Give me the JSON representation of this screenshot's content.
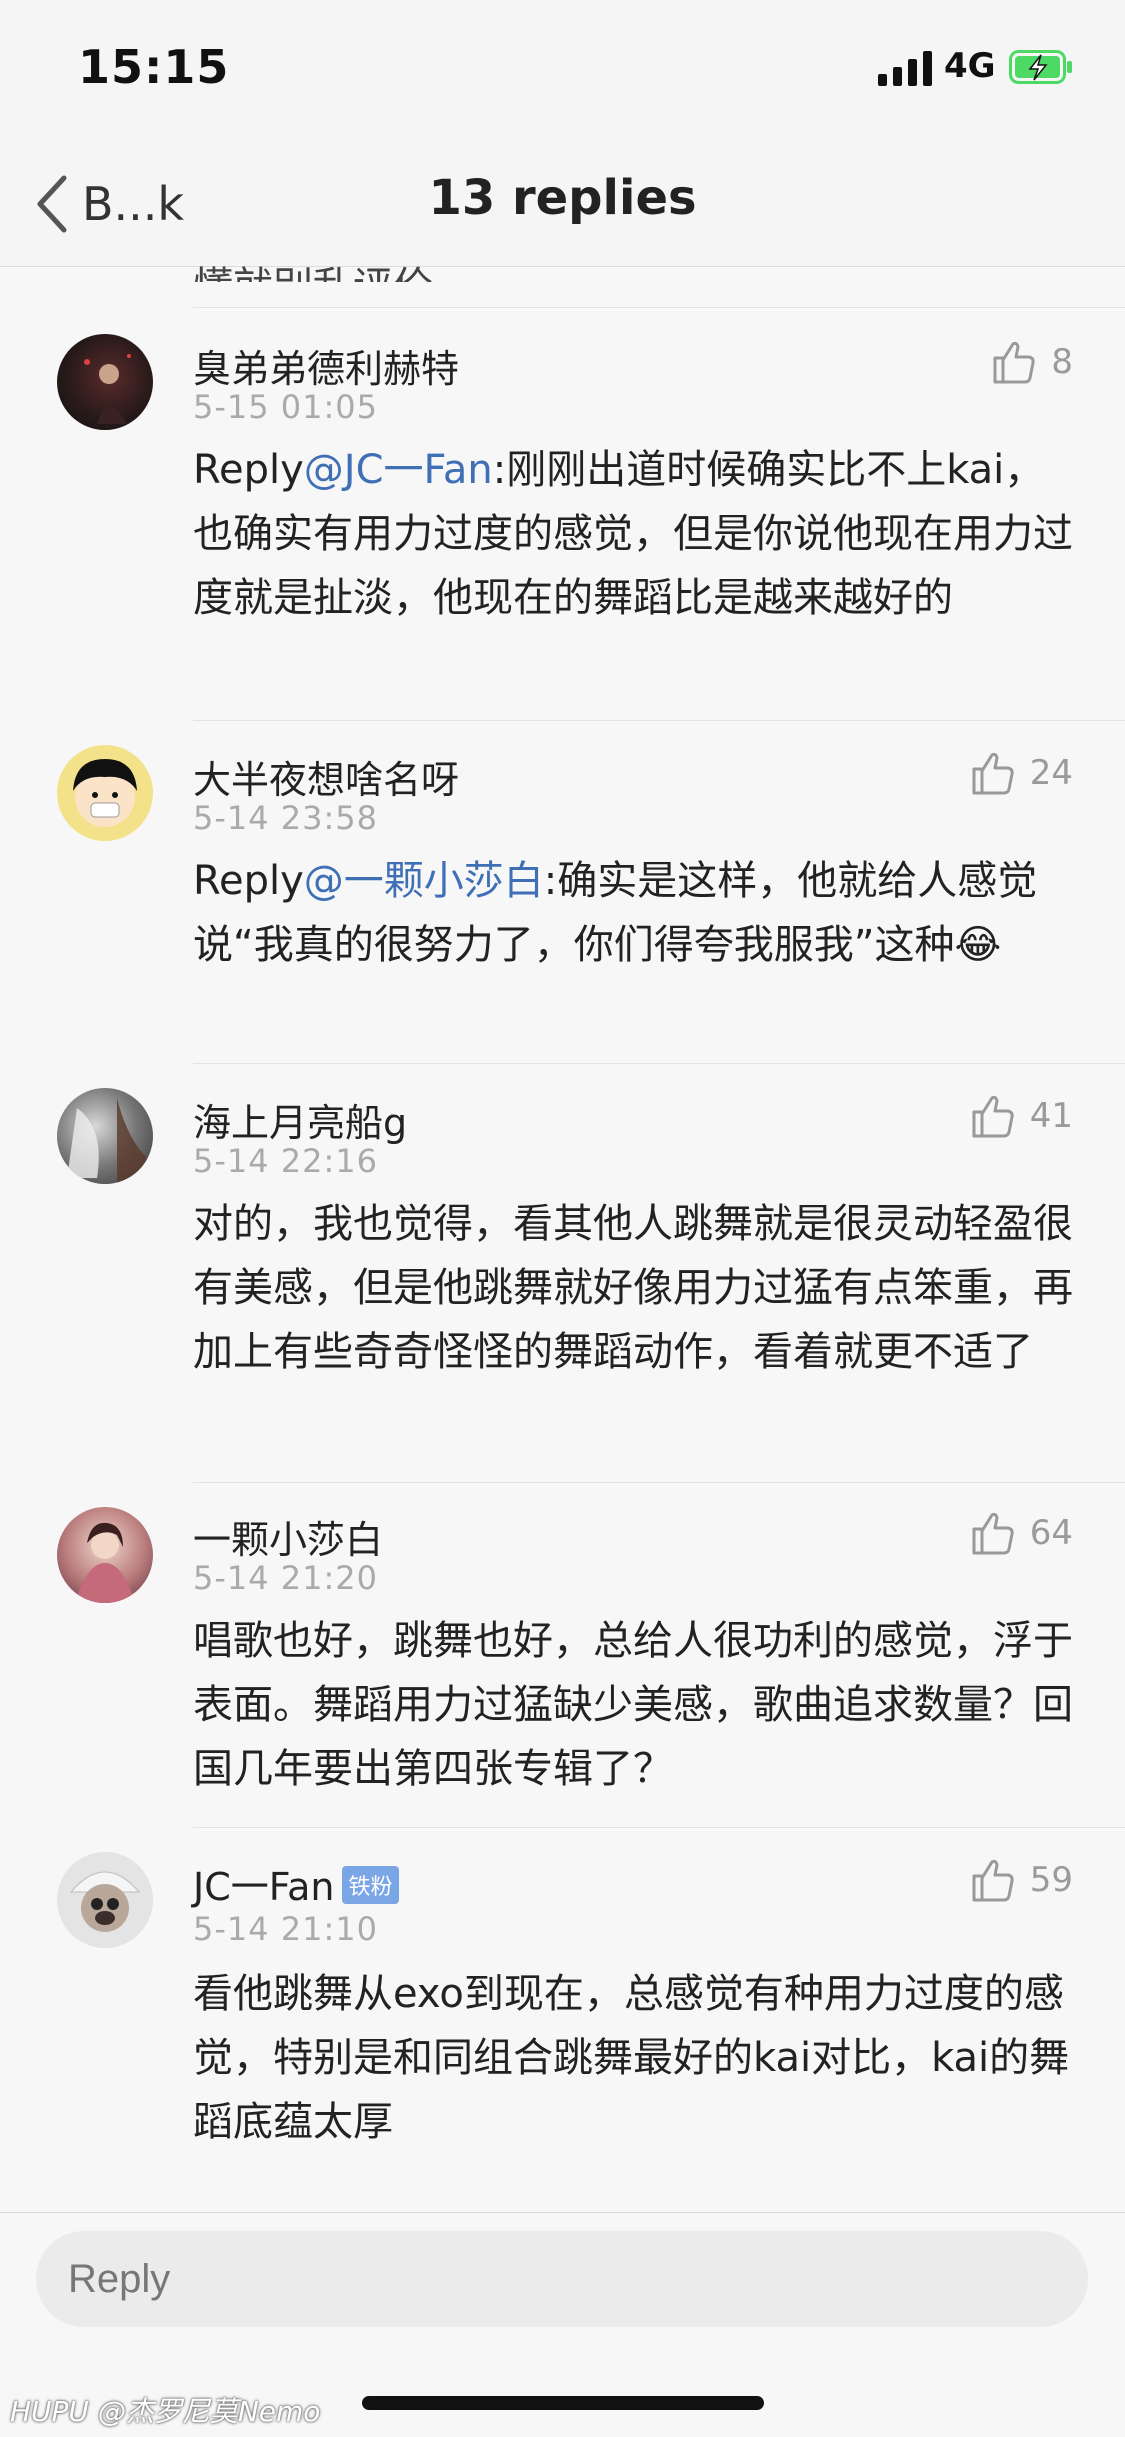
{
  "status_bar": {
    "time": "15:15",
    "network": "4G"
  },
  "nav": {
    "back_label": "B...k",
    "title": "13 replies"
  },
  "cut_off_text": "懂就别乱评价",
  "comments": [
    {
      "username": "臭弟弟德利赫特",
      "time": "5-15 01:05",
      "likes": "8",
      "reply_prefix": "Reply",
      "mention": "@JC一Fan",
      "text": ":刚刚出道时候确实比不上kai，也确实有用力过度的感觉，但是你说他现在用力过度就是扯淡，他现在的舞蹈比是越来越好的"
    },
    {
      "username": "大半夜想啥名呀",
      "time": "5-14 23:58",
      "likes": "24",
      "reply_prefix": "Reply",
      "mention": "@一颗小莎白",
      "text": ":确实是这样，他就给人感觉说“我真的很努力了，你们得夸我服我”这种😂"
    },
    {
      "username": "海上月亮船g",
      "time": "5-14 22:16",
      "likes": "41",
      "text": "对的，我也觉得，看其他人跳舞就是很灵动轻盈很有美感，但是他跳舞就好像用力过猛有点笨重，再加上有些奇奇怪怪的舞蹈动作，看着就更不适了"
    },
    {
      "username": "一颗小莎白",
      "time": "5-14 21:20",
      "likes": "64",
      "text": "唱歌也好，跳舞也好，总给人很功利的感觉，浮于表面。舞蹈用力过猛缺少美感，歌曲追求数量？回国几年要出第四张专辑了？"
    },
    {
      "username": "JC一Fan",
      "badge": "铁粉",
      "time": "5-14 21:10",
      "likes": "59",
      "text": "看他跳舞从exo到现在，总感觉有种用力过度的感觉，特别是和同组合跳舞最好的kai对比，kai的舞蹈底蕴太厚"
    }
  ],
  "input": {
    "placeholder": "Reply"
  },
  "watermark": "HUPU @杰罗尼莫Nemo",
  "colors": {
    "mention": "#3f6fb5",
    "badge": "#7aa6e6",
    "battery": "#4cd964"
  }
}
